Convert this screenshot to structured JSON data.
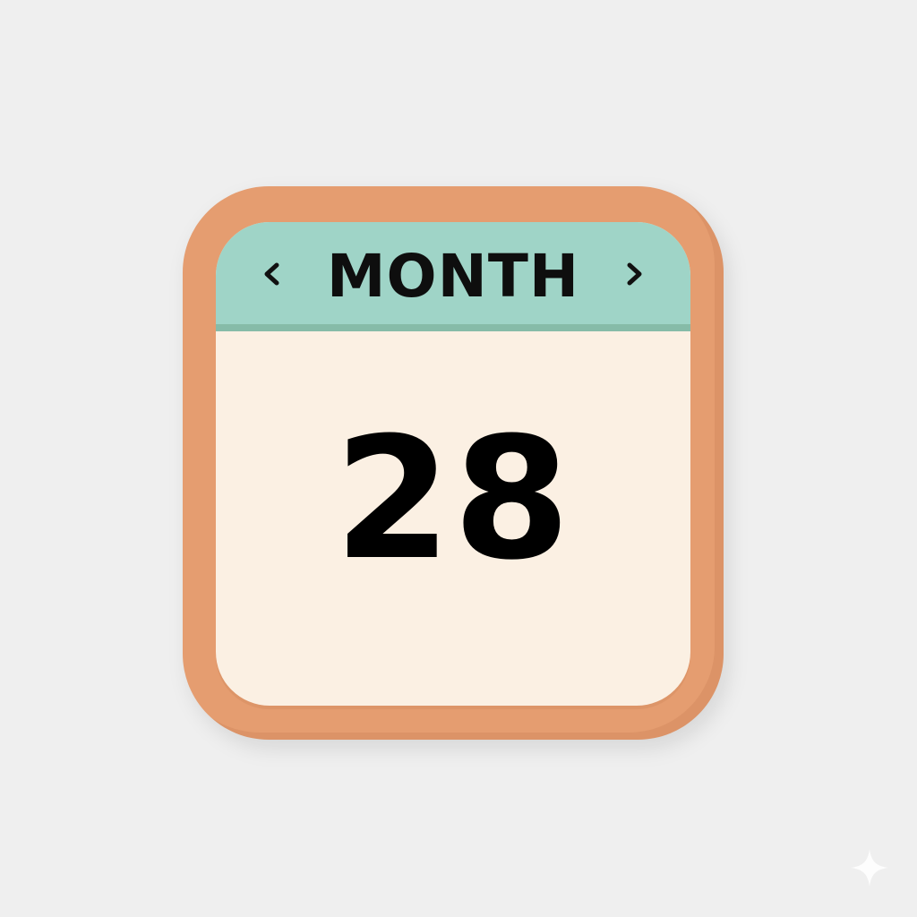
{
  "calendar": {
    "month_label": "MONTH",
    "day_number": "28",
    "prev_icon": "chevron-left-icon",
    "next_icon": "chevron-right-icon"
  },
  "colors": {
    "background": "#efefef",
    "frame": "#e59d70",
    "header": "#9fd4c7",
    "card": "#fbf0e3",
    "text": "#000000"
  },
  "decoration": {
    "corner_icon": "sparkle-icon"
  }
}
